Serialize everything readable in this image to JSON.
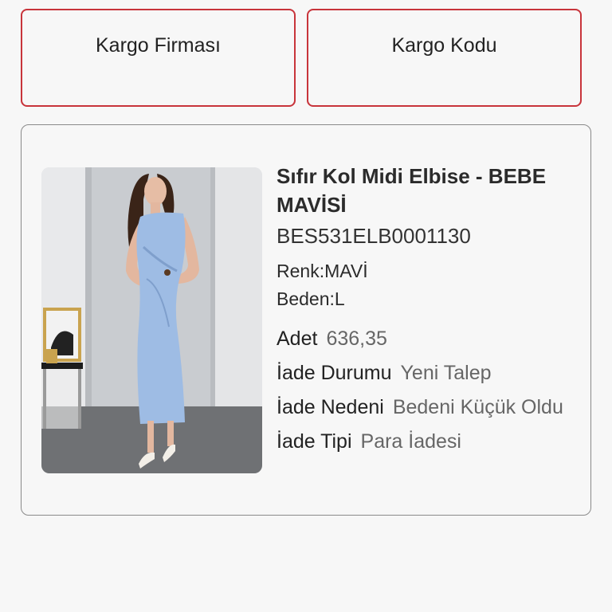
{
  "buttons": {
    "cargo_company": "Kargo Firması",
    "cargo_code": "Kargo Kodu"
  },
  "product": {
    "title": "Sıfır Kol Midi Elbise - BEBE MAVİSİ",
    "sku": "BES531ELB0001130",
    "color": "Renk:MAVİ",
    "size": "Beden:L",
    "details": {
      "quantity_label": "Adet",
      "quantity_value": "636,35",
      "return_status_label": "İade Durumu",
      "return_status_value": "Yeni Talep",
      "return_reason_label": "İade Nedeni",
      "return_reason_value": "Bedeni Küçük Oldu",
      "return_type_label": "İade Tipi",
      "return_type_value": "Para İadesi"
    }
  },
  "colors": {
    "accent_border": "#c8343b",
    "dress": "#9ebce4"
  }
}
